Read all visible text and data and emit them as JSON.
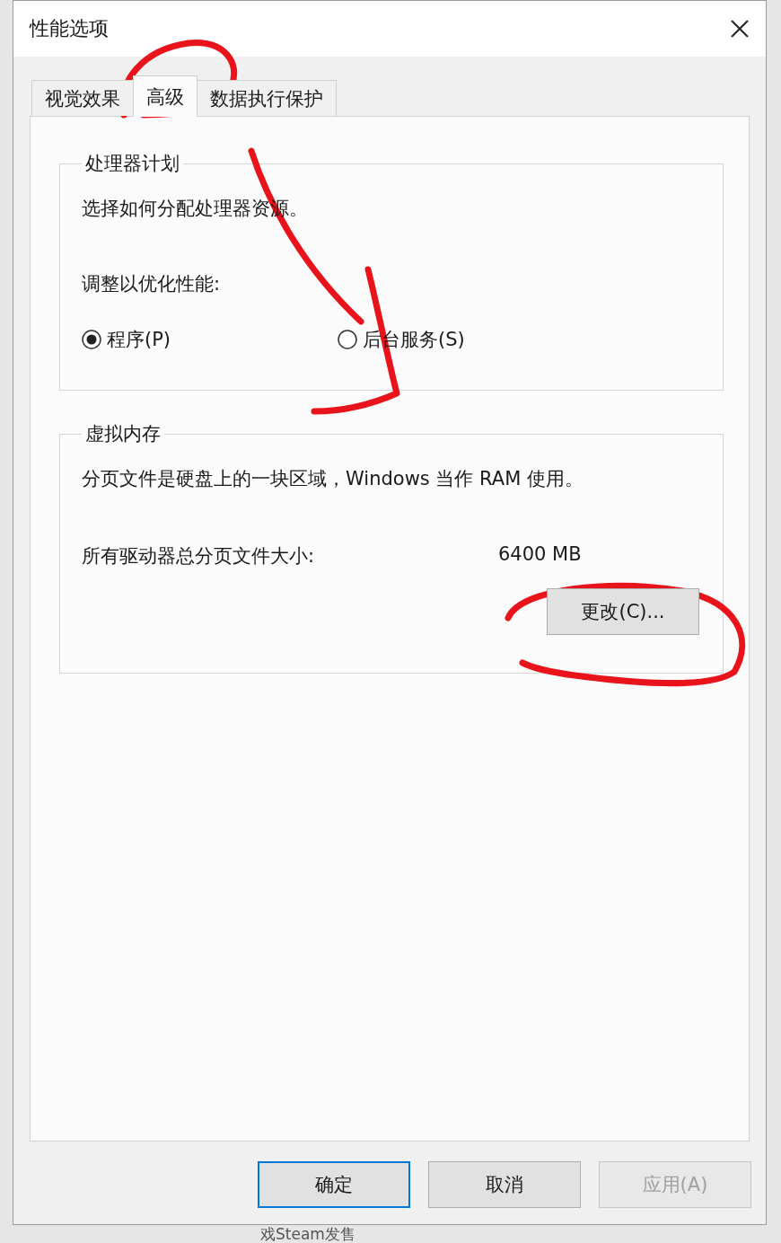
{
  "window": {
    "title": "性能选项"
  },
  "tabs": [
    {
      "label": "视觉效果",
      "selected": false
    },
    {
      "label": "高级",
      "selected": true
    },
    {
      "label": "数据执行保护",
      "selected": false
    }
  ],
  "processor_scheduling": {
    "title": "处理器计划",
    "description": "选择如何分配处理器资源。",
    "prompt": "调整以优化性能:",
    "options": [
      {
        "label": "程序(P)",
        "selected": true
      },
      {
        "label": "后台服务(S)",
        "selected": false
      }
    ]
  },
  "virtual_memory": {
    "title": "虚拟内存",
    "description": "分页文件是硬盘上的一块区域，Windows 当作 RAM 使用。",
    "size_label": "所有驱动器总分页文件大小:",
    "size_value": "6400 MB",
    "button": "更改(C)..."
  },
  "buttons": [
    {
      "label": "确定",
      "default": true,
      "disabled": false
    },
    {
      "label": "取消",
      "default": false,
      "disabled": false
    },
    {
      "label": "应用(A)",
      "default": false,
      "disabled": true
    }
  ],
  "background": {
    "text": "戏Steam发售"
  }
}
